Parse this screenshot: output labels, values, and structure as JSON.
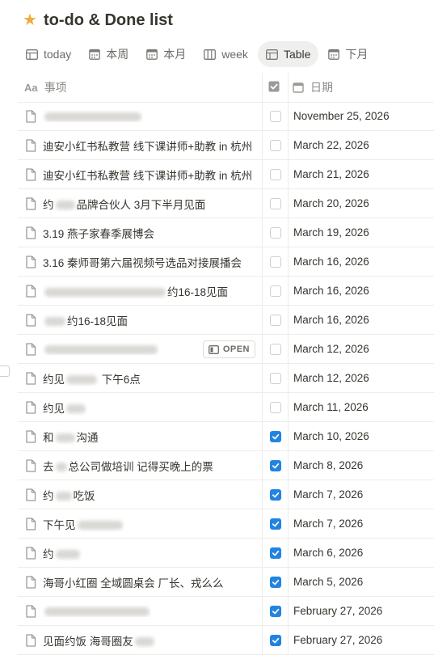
{
  "page": {
    "title": "to-do & Done list",
    "favorite_icon": "star-icon",
    "accent": "#2383e2",
    "star_color": "#f2a93b"
  },
  "tabs": [
    {
      "label": "today",
      "icon": "table-icon",
      "active": false
    },
    {
      "label": "本周",
      "icon": "calendar-icon",
      "active": false
    },
    {
      "label": "本月",
      "icon": "calendar-icon",
      "active": false
    },
    {
      "label": "week",
      "icon": "board-icon",
      "active": false
    },
    {
      "label": "Table",
      "icon": "table-icon",
      "active": true
    },
    {
      "label": "下月",
      "icon": "calendar-icon",
      "active": false
    }
  ],
  "columns": {
    "name": "事项",
    "name_icon": "Aa",
    "done_icon": "checkbox-icon",
    "date": "日期"
  },
  "row_action": {
    "open_label": "OPEN"
  },
  "rows": [
    {
      "name_pre": "",
      "blur": 120,
      "name_post": "",
      "done": false,
      "date": "November 25, 2026"
    },
    {
      "name_pre": "迪安小红书私教营 线下课讲师+助教 in 杭州",
      "blur": 0,
      "name_post": "",
      "done": false,
      "date": "March 22, 2026"
    },
    {
      "name_pre": "迪安小红书私教营 线下课讲师+助教 in 杭州",
      "blur": 0,
      "name_post": "",
      "done": false,
      "date": "March 21, 2026"
    },
    {
      "name_pre": "约",
      "blur": 24,
      "name_post": "品牌合伙人 3月下半月见面",
      "done": false,
      "date": "March 20, 2026"
    },
    {
      "name_pre": "3.19 燕子家春季展博会",
      "blur": 0,
      "name_post": "",
      "done": false,
      "date": "March 19, 2026"
    },
    {
      "name_pre": "3.16 秦师哥第六届视频号选品对接展播会",
      "blur": 0,
      "name_post": "",
      "done": false,
      "date": "March 16, 2026"
    },
    {
      "name_pre": "",
      "blur": 150,
      "name_post": "约16-18见面",
      "done": false,
      "date": "March 16, 2026"
    },
    {
      "name_pre": "",
      "blur": 26,
      "name_post": "约16-18见面",
      "done": false,
      "date": "March 16, 2026"
    },
    {
      "name_pre": "",
      "blur": 140,
      "name_post": "",
      "done": false,
      "date": "March 12, 2026",
      "show_open": true
    },
    {
      "name_pre": "约见",
      "blur": 38,
      "name_post": " 下午6点",
      "done": false,
      "date": "March 12, 2026"
    },
    {
      "name_pre": "约见",
      "blur": 24,
      "name_post": "",
      "done": false,
      "date": "March 11, 2026"
    },
    {
      "name_pre": "和",
      "blur": 24,
      "name_post": "沟通",
      "done": true,
      "date": "March 10, 2026"
    },
    {
      "name_pre": "去",
      "blur": 14,
      "name_post": "总公司做培训 记得买晚上的票",
      "done": true,
      "date": "March 8, 2026"
    },
    {
      "name_pre": "约",
      "blur": 20,
      "name_post": "吃饭",
      "done": true,
      "date": "March 7, 2026"
    },
    {
      "name_pre": "下午见",
      "blur": 56,
      "name_post": "",
      "done": true,
      "date": "March 7, 2026"
    },
    {
      "name_pre": "约",
      "blur": 30,
      "name_post": "",
      "done": true,
      "date": "March 6, 2026"
    },
    {
      "name_pre": "海哥小红圈 全域圆桌会 厂长、戎么么",
      "blur": 0,
      "name_post": "",
      "done": true,
      "date": "March 5, 2026"
    },
    {
      "name_pre": "",
      "blur": 130,
      "name_post": "",
      "done": true,
      "date": "February 27, 2026"
    },
    {
      "name_pre": "见面约饭 海哥圈友",
      "blur": 24,
      "name_post": "",
      "done": true,
      "date": "February 27, 2026"
    }
  ]
}
